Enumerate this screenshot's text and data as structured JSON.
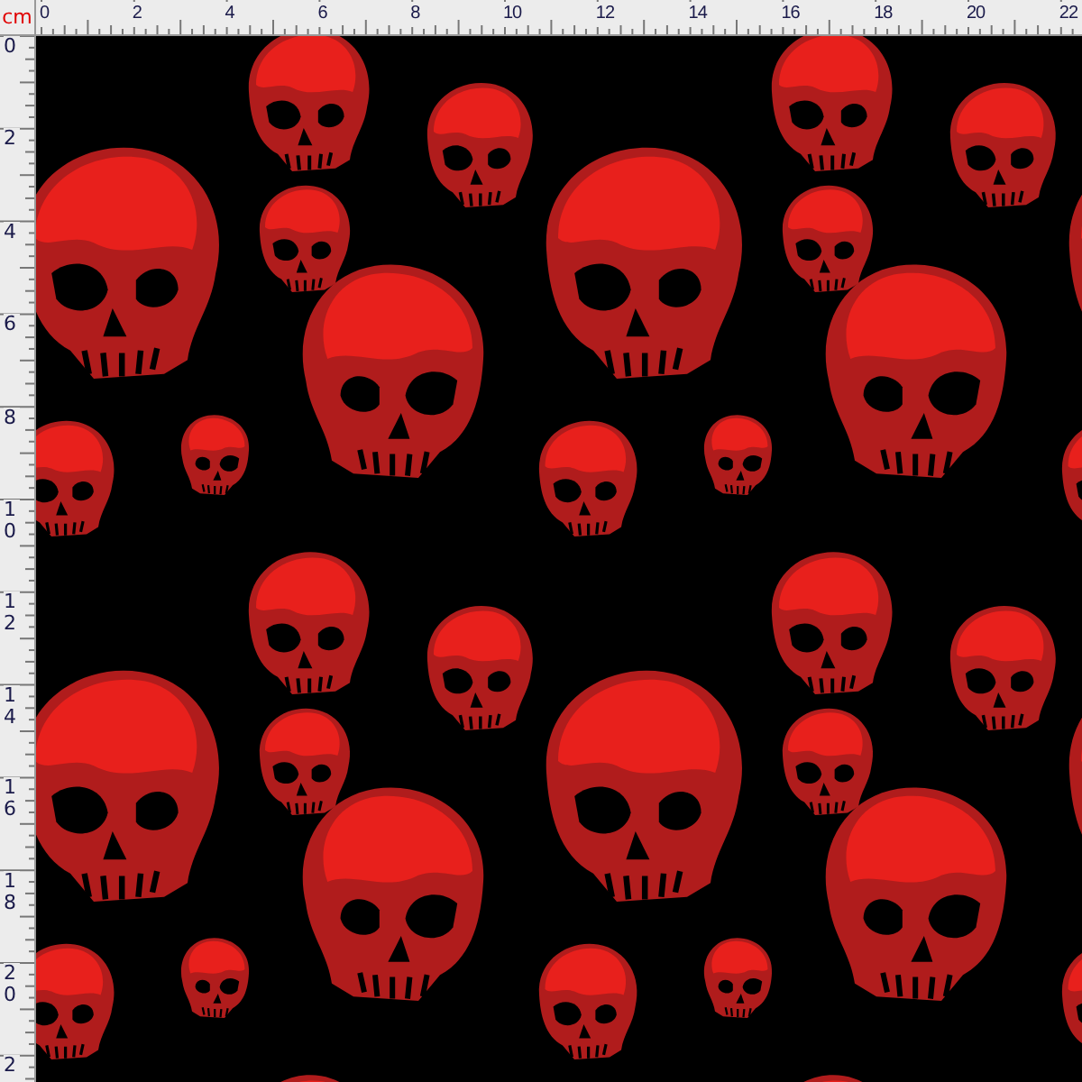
{
  "units": "cm",
  "top_ruler": {
    "labels": [
      "0",
      "2",
      "4",
      "6",
      "8",
      "10",
      "12",
      "14",
      "16",
      "18",
      "20",
      "22"
    ]
  },
  "left_ruler": {
    "labels": [
      "0",
      "2",
      "4",
      "6",
      "8",
      "10",
      "12",
      "14",
      "16",
      "18",
      "20",
      "2"
    ]
  }
}
